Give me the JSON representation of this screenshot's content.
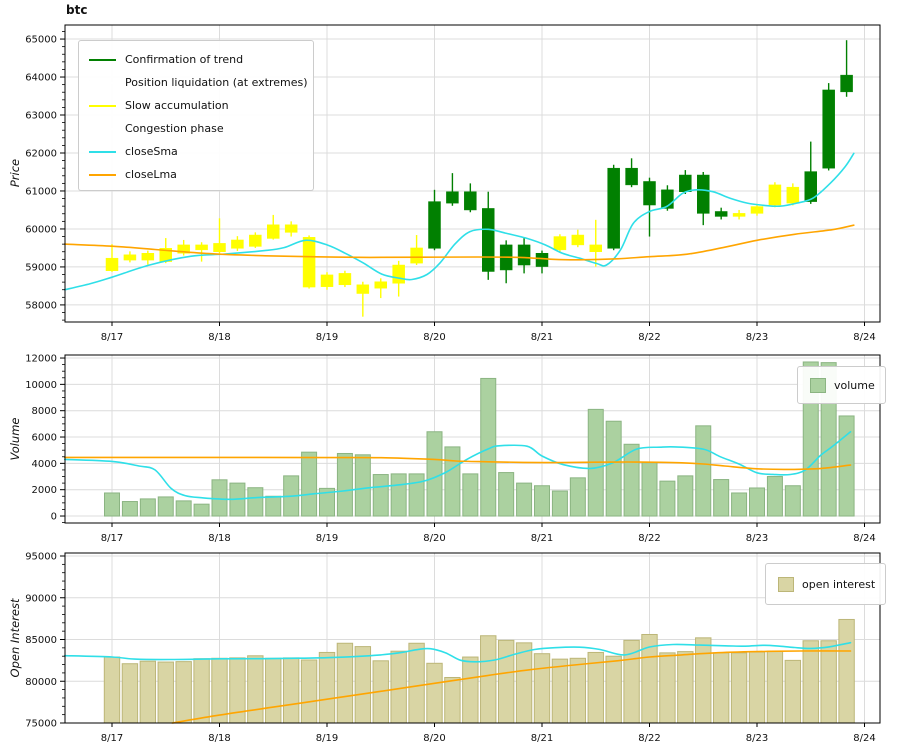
{
  "title": "btc",
  "axes": {
    "price_label": "Price",
    "volume_label": "Volume",
    "oi_label": "Open Interest"
  },
  "legend_price": {
    "items": [
      {
        "label": "Confirmation of trend",
        "color": "#018001"
      },
      {
        "label": "Position liquidation (at extremes)",
        "color": "#ffffff"
      },
      {
        "label": "Slow accumulation",
        "color": "#ffff00"
      },
      {
        "label": "Congestion phase",
        "color": "#ffffff"
      },
      {
        "label": "closeSma",
        "color": "#2fdfe8"
      },
      {
        "label": "closeLma",
        "color": "#ffa500"
      }
    ]
  },
  "legend_volume": {
    "label": "volume"
  },
  "legend_oi": {
    "label": "open interest"
  },
  "colors": {
    "trend": "#018001",
    "accumulation": "#ffff00",
    "sma": "#2fdfe8",
    "lma": "#ffa500",
    "volume_bar": "#abd1a0",
    "volume_edge": "#8bb482",
    "oi_bar": "#d9d5a4",
    "oi_edge": "#bcb678",
    "grid": "#dcdcdc",
    "spine": "#000000",
    "text": "#111111"
  },
  "chart_data": {
    "type": "candlestick-multi-panel",
    "x_tick_labels": [
      "8/17",
      "8/18",
      "8/19",
      "8/20",
      "8/21",
      "8/22",
      "8/23",
      "8/24"
    ],
    "candles_per_day": 6,
    "panels": [
      {
        "name": "price",
        "ylabel": "Price",
        "yticks": [
          58000,
          59000,
          60000,
          61000,
          62000,
          63000,
          64000,
          65000
        ],
        "minor_step": 200,
        "ylim": [
          57550,
          65370
        ]
      },
      {
        "name": "volume",
        "ylabel": "Volume",
        "yticks": [
          0,
          2000,
          4000,
          6000,
          8000,
          10000,
          12000
        ],
        "minor_step": 500,
        "ylim": [
          -530,
          12230
        ]
      },
      {
        "name": "open_interest",
        "ylabel": "Open Interest",
        "yticks": [
          75000,
          80000,
          85000,
          90000,
          95000
        ],
        "minor_step": 1000,
        "ylim": [
          75000,
          95360
        ]
      }
    ],
    "candles": {
      "columns": [
        "open",
        "high",
        "low",
        "close",
        "phase"
      ],
      "rows": [
        [
          58900,
          59600,
          58870,
          59230,
          "accum"
        ],
        [
          59180,
          59410,
          59120,
          59320,
          "accum"
        ],
        [
          59360,
          59430,
          59060,
          59180,
          "accum"
        ],
        [
          59140,
          59760,
          59100,
          59490,
          "accum"
        ],
        [
          59360,
          59710,
          59300,
          59580,
          "accum"
        ],
        [
          59580,
          59650,
          59140,
          59450,
          "accum"
        ],
        [
          59400,
          60280,
          59360,
          59620,
          "accum"
        ],
        [
          59490,
          59810,
          59420,
          59710,
          "accum"
        ],
        [
          59540,
          59910,
          59500,
          59840,
          "accum"
        ],
        [
          59750,
          60370,
          59720,
          60110,
          "accum"
        ],
        [
          60110,
          60200,
          59800,
          59910,
          "accum"
        ],
        [
          59780,
          59830,
          58430,
          58470,
          "accum"
        ],
        [
          58480,
          58860,
          58400,
          58790,
          "accum"
        ],
        [
          58830,
          58900,
          58470,
          58530,
          "accum"
        ],
        [
          58530,
          58610,
          57690,
          58300,
          "accum"
        ],
        [
          58440,
          58700,
          58180,
          58610,
          "accum"
        ],
        [
          58570,
          59160,
          58220,
          59050,
          "accum"
        ],
        [
          59100,
          59840,
          59050,
          59500,
          "accum"
        ],
        [
          59490,
          61030,
          59440,
          60720,
          "trend"
        ],
        [
          60680,
          61470,
          60610,
          60980,
          "trend"
        ],
        [
          60980,
          61200,
          60440,
          60500,
          "trend"
        ],
        [
          60540,
          60980,
          58660,
          58880,
          "trend"
        ],
        [
          58920,
          59700,
          58570,
          59580,
          "trend"
        ],
        [
          59580,
          59760,
          58830,
          59050,
          "trend"
        ],
        [
          59010,
          59430,
          58830,
          59360,
          "trend"
        ],
        [
          59450,
          59860,
          59400,
          59800,
          "accum"
        ],
        [
          59580,
          59980,
          59520,
          59840,
          "accum"
        ],
        [
          59580,
          60240,
          59010,
          59400,
          "accum"
        ],
        [
          59490,
          61690,
          59440,
          61600,
          "trend"
        ],
        [
          61600,
          61860,
          61100,
          61160,
          "trend"
        ],
        [
          61250,
          61350,
          59800,
          60630,
          "trend"
        ],
        [
          60540,
          61150,
          60480,
          61030,
          "trend"
        ],
        [
          60980,
          61550,
          60920,
          61420,
          "trend"
        ],
        [
          61420,
          61500,
          60100,
          60410,
          "trend"
        ],
        [
          60460,
          60560,
          60250,
          60330,
          "trend"
        ],
        [
          60330,
          60500,
          60250,
          60410,
          "accum"
        ],
        [
          60410,
          60660,
          60350,
          60590,
          "accum"
        ],
        [
          60630,
          61230,
          60570,
          61160,
          "accum"
        ],
        [
          61100,
          61200,
          60620,
          60680,
          "accum"
        ],
        [
          60720,
          62300,
          60660,
          61510,
          "trend"
        ],
        [
          61600,
          63840,
          61540,
          63660,
          "trend"
        ],
        [
          63610,
          64970,
          63480,
          64050,
          "trend"
        ]
      ]
    },
    "volume": [
      1750,
      1100,
      1300,
      1450,
      1150,
      900,
      2750,
      2500,
      2150,
      1500,
      3050,
      4850,
      2100,
      4750,
      4650,
      3150,
      3200,
      3200,
      6400,
      5250,
      3200,
      10450,
      3300,
      2500,
      2300,
      1900,
      2900,
      8100,
      7200,
      5450,
      4050,
      2650,
      3050,
      6850,
      2770,
      1750,
      2130,
      3000,
      2300,
      11700,
      11650,
      7600
    ],
    "open_interest": [
      82900,
      82100,
      82400,
      82300,
      82350,
      82700,
      82750,
      82800,
      83050,
      82750,
      82800,
      82550,
      83450,
      84550,
      84150,
      82450,
      83600,
      84550,
      82150,
      80450,
      82900,
      85450,
      84900,
      84600,
      83300,
      82650,
      82750,
      83450,
      83000,
      84900,
      85600,
      83400,
      83550,
      85200,
      83400,
      83400,
      83500,
      83600,
      82500,
      84850,
      84850,
      87400
    ],
    "lines": {
      "close_sma": [
        [
          -0.44,
          58400
        ],
        [
          -0.2,
          58560
        ],
        [
          0,
          58730
        ],
        [
          0.35,
          59050
        ],
        [
          0.73,
          59280
        ],
        [
          1.05,
          59340
        ],
        [
          1.42,
          59430
        ],
        [
          1.6,
          59510
        ],
        [
          1.8,
          59700
        ],
        [
          2.0,
          59580
        ],
        [
          2.17,
          59360
        ],
        [
          2.34,
          59100
        ],
        [
          2.51,
          58810
        ],
        [
          2.68,
          58700
        ],
        [
          2.79,
          58670
        ],
        [
          2.93,
          58800
        ],
        [
          3.05,
          59100
        ],
        [
          3.19,
          59600
        ],
        [
          3.33,
          59930
        ],
        [
          3.5,
          59990
        ],
        [
          3.66,
          59890
        ],
        [
          3.86,
          59750
        ],
        [
          4.03,
          59580
        ],
        [
          4.19,
          59360
        ],
        [
          4.35,
          59230
        ],
        [
          4.51,
          59090
        ],
        [
          4.6,
          59050
        ],
        [
          4.73,
          59450
        ],
        [
          4.85,
          60150
        ],
        [
          5.0,
          60460
        ],
        [
          5.16,
          60590
        ],
        [
          5.31,
          60940
        ],
        [
          5.44,
          61030
        ],
        [
          5.59,
          60980
        ],
        [
          5.75,
          60810
        ],
        [
          5.91,
          60680
        ],
        [
          6.07,
          60620
        ],
        [
          6.21,
          60600
        ],
        [
          6.37,
          60680
        ],
        [
          6.52,
          60810
        ],
        [
          6.68,
          61200
        ],
        [
          6.82,
          61640
        ],
        [
          6.9,
          61990
        ]
      ],
      "close_lma": [
        [
          -0.44,
          59600
        ],
        [
          0,
          59545
        ],
        [
          0.4,
          59460
        ],
        [
          0.9,
          59350
        ],
        [
          1.4,
          59295
        ],
        [
          1.9,
          59268
        ],
        [
          2.4,
          59252
        ],
        [
          2.9,
          59255
        ],
        [
          3.4,
          59262
        ],
        [
          3.8,
          59250
        ],
        [
          4.1,
          59200
        ],
        [
          4.35,
          59188
        ],
        [
          4.7,
          59215
        ],
        [
          5.0,
          59270
        ],
        [
          5.35,
          59335
        ],
        [
          5.7,
          59520
        ],
        [
          6.0,
          59700
        ],
        [
          6.35,
          59860
        ],
        [
          6.7,
          59980
        ],
        [
          6.9,
          60100
        ]
      ],
      "volume_sma": [
        [
          -0.44,
          4300
        ],
        [
          0,
          4150
        ],
        [
          0.25,
          3800
        ],
        [
          0.4,
          3500
        ],
        [
          0.55,
          2100
        ],
        [
          0.68,
          1550
        ],
        [
          0.85,
          1380
        ],
        [
          1.1,
          1270
        ],
        [
          1.35,
          1400
        ],
        [
          1.65,
          1500
        ],
        [
          1.9,
          1700
        ],
        [
          2.15,
          1900
        ],
        [
          2.4,
          2150
        ],
        [
          2.65,
          2350
        ],
        [
          2.9,
          2650
        ],
        [
          3.1,
          3300
        ],
        [
          3.3,
          4300
        ],
        [
          3.5,
          5100
        ],
        [
          3.6,
          5330
        ],
        [
          3.86,
          5300
        ],
        [
          4.0,
          4560
        ],
        [
          4.2,
          3900
        ],
        [
          4.45,
          3615
        ],
        [
          4.66,
          4050
        ],
        [
          4.88,
          5080
        ],
        [
          5.1,
          5230
        ],
        [
          5.24,
          5250
        ],
        [
          5.5,
          5080
        ],
        [
          5.66,
          4500
        ],
        [
          5.84,
          3920
        ],
        [
          6.0,
          3280
        ],
        [
          6.15,
          3160
        ],
        [
          6.31,
          3150
        ],
        [
          6.45,
          3500
        ],
        [
          6.59,
          4600
        ],
        [
          6.71,
          5330
        ],
        [
          6.87,
          6400
        ]
      ],
      "volume_lma": [
        [
          -0.44,
          4450
        ],
        [
          0,
          4450
        ],
        [
          1.0,
          4450
        ],
        [
          2.0,
          4440
        ],
        [
          2.5,
          4430
        ],
        [
          3.0,
          4300
        ],
        [
          3.2,
          4180
        ],
        [
          3.5,
          4120
        ],
        [
          4.0,
          4060
        ],
        [
          4.5,
          4090
        ],
        [
          4.8,
          4100
        ],
        [
          5.1,
          4080
        ],
        [
          5.3,
          4040
        ],
        [
          5.5,
          3950
        ],
        [
          5.7,
          3800
        ],
        [
          6.0,
          3590
        ],
        [
          6.3,
          3540
        ],
        [
          6.6,
          3620
        ],
        [
          6.87,
          3870
        ]
      ],
      "oi_sma": [
        [
          -0.44,
          83060
        ],
        [
          0,
          82900
        ],
        [
          0.21,
          82650
        ],
        [
          0.54,
          82600
        ],
        [
          1.0,
          82690
        ],
        [
          1.4,
          82700
        ],
        [
          1.75,
          82760
        ],
        [
          2.0,
          82820
        ],
        [
          2.26,
          82950
        ],
        [
          2.5,
          83160
        ],
        [
          2.68,
          83420
        ],
        [
          2.85,
          83820
        ],
        [
          2.96,
          83900
        ],
        [
          3.1,
          83420
        ],
        [
          3.24,
          82520
        ],
        [
          3.38,
          82330
        ],
        [
          3.56,
          82550
        ],
        [
          3.75,
          83250
        ],
        [
          3.93,
          83800
        ],
        [
          4.12,
          84020
        ],
        [
          4.35,
          84080
        ],
        [
          4.54,
          83800
        ],
        [
          4.77,
          83150
        ],
        [
          5.0,
          84100
        ],
        [
          5.22,
          84400
        ],
        [
          5.47,
          84330
        ],
        [
          5.7,
          84250
        ],
        [
          5.89,
          84200
        ],
        [
          6.07,
          84300
        ],
        [
          6.21,
          84200
        ],
        [
          6.35,
          84040
        ],
        [
          6.5,
          83930
        ],
        [
          6.67,
          84120
        ],
        [
          6.87,
          84620
        ]
      ],
      "oi_lma": [
        [
          0.56,
          75000
        ],
        [
          1.0,
          75950
        ],
        [
          1.5,
          76900
        ],
        [
          2.0,
          77850
        ],
        [
          2.5,
          78800
        ],
        [
          3.0,
          79750
        ],
        [
          3.5,
          80700
        ],
        [
          3.9,
          81400
        ],
        [
          4.3,
          81950
        ],
        [
          4.7,
          82450
        ],
        [
          5.0,
          82900
        ],
        [
          5.3,
          83150
        ],
        [
          5.6,
          83400
        ],
        [
          6.0,
          83550
        ],
        [
          6.4,
          83620
        ],
        [
          6.87,
          83620
        ]
      ]
    }
  }
}
